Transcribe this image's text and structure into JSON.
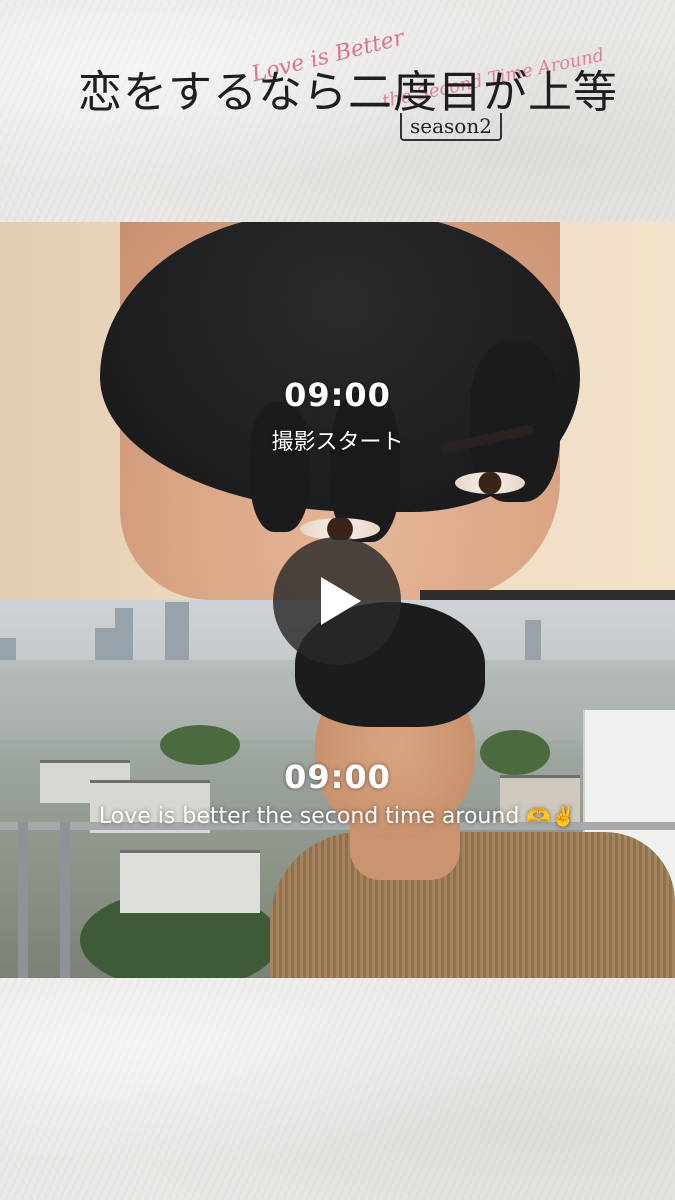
{
  "header": {
    "title_jp": "恋をするなら二度目が上等",
    "subtitle_script_1": "Love is Better",
    "subtitle_script_2": "the Second Time Around",
    "season_label": "season2"
  },
  "clip_top": {
    "time": "09:00",
    "caption": "撮影スタート"
  },
  "clip_bottom": {
    "time": "09:00",
    "caption": "Love is better the second time around",
    "emoji": "🫶✌️"
  },
  "player": {
    "play_icon": "play-icon"
  },
  "colors": {
    "paper": "#e9e8e5",
    "script_pink": "#d9617d",
    "overlay_text": "#ffffff",
    "play_bg": "#282828"
  }
}
